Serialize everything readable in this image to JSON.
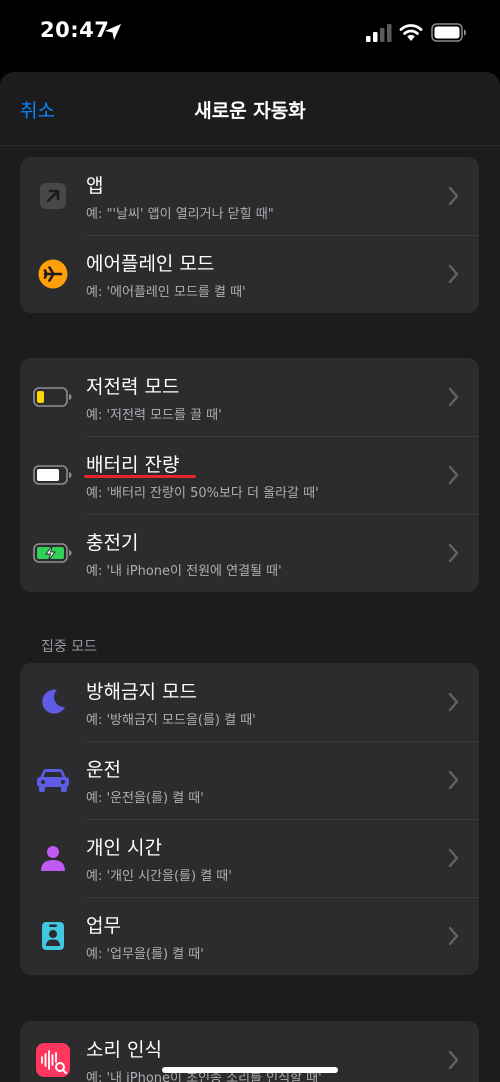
{
  "status": {
    "time": "20:47"
  },
  "nav": {
    "cancel": "취소",
    "title": "새로운 자동화"
  },
  "groups": [
    [
      {
        "title": "앱",
        "subtitle": "예: \"'날씨' 앱이 열리거나 닫힐 때\"",
        "icon": "app-arrow-icon"
      },
      {
        "title": "에어플레인 모드",
        "subtitle": "예: '에어플레인 모드를 켤 때'",
        "icon": "airplane-icon"
      }
    ],
    [
      {
        "title": "저전력 모드",
        "subtitle": "예: '저전력 모드를 끌 때'",
        "icon": "low-power-battery-icon"
      },
      {
        "title": "배터리 잔량",
        "subtitle": "예: '배터리 잔량이 50%보다 더 올라갈 때'",
        "icon": "battery-level-icon"
      },
      {
        "title": "충전기",
        "subtitle": "예: '내 iPhone이 전원에 연결될 때'",
        "icon": "charging-battery-icon"
      }
    ],
    [
      {
        "title": "방해금지 모드",
        "subtitle": "예: '방해금지 모드을(를) 켤 때'",
        "icon": "moon-icon"
      },
      {
        "title": "운전",
        "subtitle": "예: '운전을(를) 켤 때'",
        "icon": "car-icon"
      },
      {
        "title": "개인 시간",
        "subtitle": "예: '개인 시간을(를) 켤 때'",
        "icon": "person-icon"
      },
      {
        "title": "업무",
        "subtitle": "예: '업무을(를) 켤 때'",
        "icon": "work-badge-icon"
      }
    ],
    [
      {
        "title": "소리 인식",
        "subtitle": "예: '내 iPhone이 초인종 소리를 인식할 때'",
        "icon": "sound-recognition-icon"
      }
    ]
  ],
  "section_headers": {
    "focus": "집중 모드"
  },
  "colors": {
    "accent": "#0a84ff",
    "airplane": "#ff9f0a",
    "low_power": "#ffd60a",
    "charging": "#30d158",
    "moon": "#5e5ce6",
    "car": "#5e5ce6",
    "person": "#bf5af2",
    "work": "#40c8e0",
    "sound": "#ff375f",
    "underline": "#e8242c"
  }
}
